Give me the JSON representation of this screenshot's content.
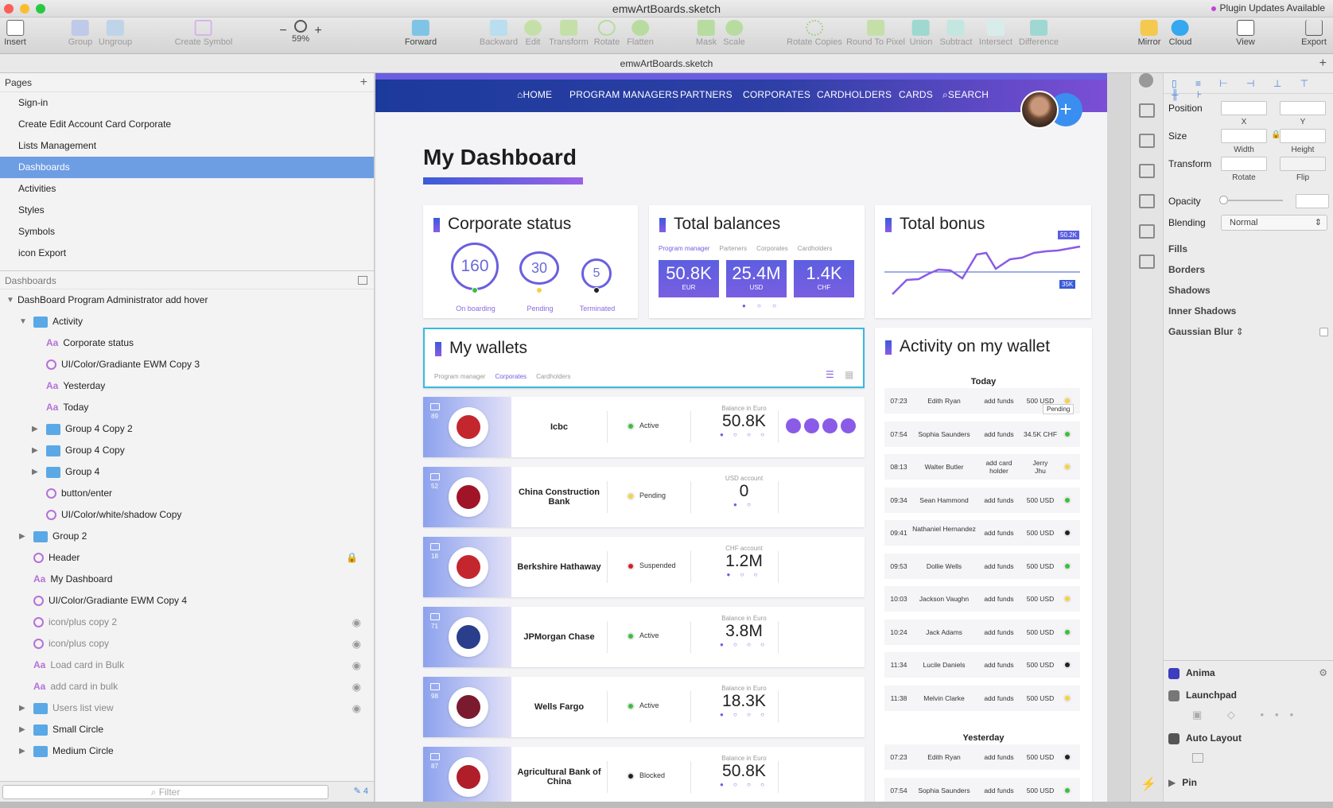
{
  "window": {
    "title": "emwArtBoards.sketch",
    "plugin_notice": "Plugin Updates Available",
    "doc_tab": "emwArtBoards.sketch"
  },
  "toolbar": {
    "insert": "Insert",
    "group": "Group",
    "ungroup": "Ungroup",
    "create_symbol": "Create Symbol",
    "zoom_minus": "−",
    "zoom_plus": "+",
    "zoom": "59%",
    "forward": "Forward",
    "backward": "Backward",
    "edit": "Edit",
    "transform": "Transform",
    "rotate": "Rotate",
    "flatten": "Flatten",
    "mask": "Mask",
    "scale": "Scale",
    "rotate_copies": "Rotate Copies",
    "round_to_pixel": "Round To Pixel",
    "union": "Union",
    "subtract": "Subtract",
    "intersect": "Intersect",
    "difference": "Difference",
    "mirror": "Mirror",
    "cloud": "Cloud",
    "view": "View",
    "export": "Export"
  },
  "pages": {
    "header": "Pages",
    "items": [
      "Sign-in",
      "Create Edit Account Card Corporate",
      "Lists Management",
      "Dashboards",
      "Activities",
      "Styles",
      "Symbols",
      "icon Export"
    ],
    "selected": "Dashboards"
  },
  "layers": {
    "header": "Dashboards",
    "filter_placeholder": "Filter",
    "filter_count": "4",
    "items": [
      {
        "label": "DashBoard Program Administrator add hover",
        "type": "artboard"
      },
      {
        "label": "Activity",
        "type": "folder"
      },
      {
        "label": "Corporate status",
        "type": "text"
      },
      {
        "label": "UI/Color/Gradiante EWM Copy 3",
        "type": "symbol"
      },
      {
        "label": "Yesterday",
        "type": "text"
      },
      {
        "label": "Today",
        "type": "text"
      },
      {
        "label": "Group 4 Copy 2",
        "type": "folder"
      },
      {
        "label": "Group 4 Copy",
        "type": "folder"
      },
      {
        "label": "Group 4",
        "type": "folder"
      },
      {
        "label": "button/enter",
        "type": "symbol"
      },
      {
        "label": "UI/Color/white/shadow Copy",
        "type": "symbol"
      },
      {
        "label": "Group 2",
        "type": "folder"
      },
      {
        "label": "Header",
        "type": "symbol"
      },
      {
        "label": "My Dashboard",
        "type": "text"
      },
      {
        "label": "UI/Color/Gradiante EWM Copy 4",
        "type": "symbol"
      },
      {
        "label": "icon/plus copy 2",
        "type": "symbol"
      },
      {
        "label": "icon/plus copy",
        "type": "symbol"
      },
      {
        "label": "Load card in Bulk",
        "type": "text"
      },
      {
        "label": "add card in bulk",
        "type": "text"
      },
      {
        "label": "Users list view",
        "type": "folder"
      },
      {
        "label": "Small Circle",
        "type": "folder"
      },
      {
        "label": "Medium Circle",
        "type": "folder"
      }
    ]
  },
  "nav": {
    "home": "HOME",
    "program_managers": "PROGRAM MANAGERS",
    "partners": "PARTNERS",
    "corporates": "CORPORATES",
    "cardholders": "CARDHOLDERS",
    "cards": "CARDS",
    "search": "SEARCH",
    "fab": "+"
  },
  "dashboard": {
    "title": "My Dashboard",
    "corporate_status": {
      "title": "Corporate status",
      "onboarding_value": "160",
      "onboarding_label": "On boarding",
      "pending_value": "30",
      "pending_label": "Pending",
      "terminated_value": "5",
      "terminated_label": "Terminated"
    },
    "total_balances": {
      "title": "Total balances",
      "tabs": [
        "Program manager",
        "Parteners",
        "Corporates",
        "Cardholders"
      ],
      "eur_value": "50.8K",
      "eur": "EUR",
      "usd_value": "25.4M",
      "usd": "USD",
      "chf_value": "1.4K",
      "chf": "CHF"
    },
    "total_bonus": {
      "title": "Total bonus",
      "high_label": "50.2K",
      "low_label": "35K"
    },
    "wallets": {
      "title": "My wallets",
      "tabs": [
        "Program manager",
        "Corporates",
        "Cardholders"
      ],
      "rows": [
        {
          "num": "89",
          "name": "Icbc",
          "status": "Active",
          "account": "Balance in Euro",
          "value": "50.8K"
        },
        {
          "num": "52",
          "name": "China Construction Bank",
          "status": "Pending",
          "account": "USD account",
          "value": "0"
        },
        {
          "num": "18",
          "name": "Berkshire Hathaway",
          "status": "Suspended",
          "account": "CHF account",
          "value": "1.2M"
        },
        {
          "num": "71",
          "name": "JPMorgan Chase",
          "status": "Active",
          "account": "Balance in Euro",
          "value": "3.8M"
        },
        {
          "num": "98",
          "name": "Wells Fargo",
          "status": "Active",
          "account": "Balance in Euro",
          "value": "18.3K"
        },
        {
          "num": "87",
          "name": "Agricultural Bank of China",
          "status": "Blocked",
          "account": "Balance in Euro",
          "value": "50.8K"
        }
      ]
    },
    "activity": {
      "title": "Activity on my wallet",
      "today": "Today",
      "yesterday": "Yesterday",
      "tooltip": "Pending",
      "rows": [
        {
          "time": "07:23",
          "name": "Edith Ryan",
          "action": "add funds",
          "amount": "500 USD",
          "status": "#f6d33c"
        },
        {
          "time": "07:54",
          "name": "Sophia Saunders",
          "action": "add funds",
          "amount": "34.5K CHF",
          "status": "#3cbf3c"
        },
        {
          "time": "08:13",
          "name": "Walter Butler",
          "action": "add card holder",
          "amount": "Jerry Jhu",
          "status": "#f6d33c"
        },
        {
          "time": "09:34",
          "name": "Sean Hammond",
          "action": "add funds",
          "amount": "500 USD",
          "status": "#3cbf3c"
        },
        {
          "time": "09:41",
          "name": "Nathaniel Hernandez",
          "action": "add funds",
          "amount": "500 USD",
          "status": "#222222"
        },
        {
          "time": "09:53",
          "name": "Dollie Wells",
          "action": "add funds",
          "amount": "500 USD",
          "status": "#3cbf3c"
        },
        {
          "time": "10:03",
          "name": "Jackson Vaughn",
          "action": "add funds",
          "amount": "500 USD",
          "status": "#f6d33c"
        },
        {
          "time": "10:24",
          "name": "Jack Adams",
          "action": "add funds",
          "amount": "500 USD",
          "status": "#3cbf3c"
        },
        {
          "time": "11:34",
          "name": "Lucile Daniels",
          "action": "add funds",
          "amount": "500 USD",
          "status": "#222222"
        },
        {
          "time": "11:38",
          "name": "Melvin Clarke",
          "action": "add funds",
          "amount": "500 USD",
          "status": "#f6d33c"
        }
      ],
      "yesterday_rows": [
        {
          "time": "07:23",
          "name": "Edith Ryan",
          "action": "add funds",
          "amount": "500 USD",
          "status": "#222222"
        },
        {
          "time": "07:54",
          "name": "Sophia Saunders",
          "action": "add funds",
          "amount": "500 USD",
          "status": "#3cbf3c"
        }
      ]
    }
  },
  "inspector": {
    "position": "Position",
    "x": "X",
    "y": "Y",
    "size": "Size",
    "width": "Width",
    "height": "Height",
    "transform": "Transform",
    "rotate": "Rotate",
    "flip": "Flip",
    "opacity": "Opacity",
    "blending": "Blending",
    "blending_value": "Normal",
    "fills": "Fills",
    "borders": "Borders",
    "shadows": "Shadows",
    "inner_shadows": "Inner Shadows",
    "gaussian_blur": "Gaussian Blur",
    "anima": "Anima",
    "launchpad": "Launchpad",
    "auto_layout": "Auto Layout",
    "pin": "Pin"
  },
  "colors": {
    "accent": "#6d9de3",
    "active": "#3cbf3c",
    "pending": "#f6d33c",
    "suspended": "#d0202a",
    "blocked": "#222222"
  }
}
